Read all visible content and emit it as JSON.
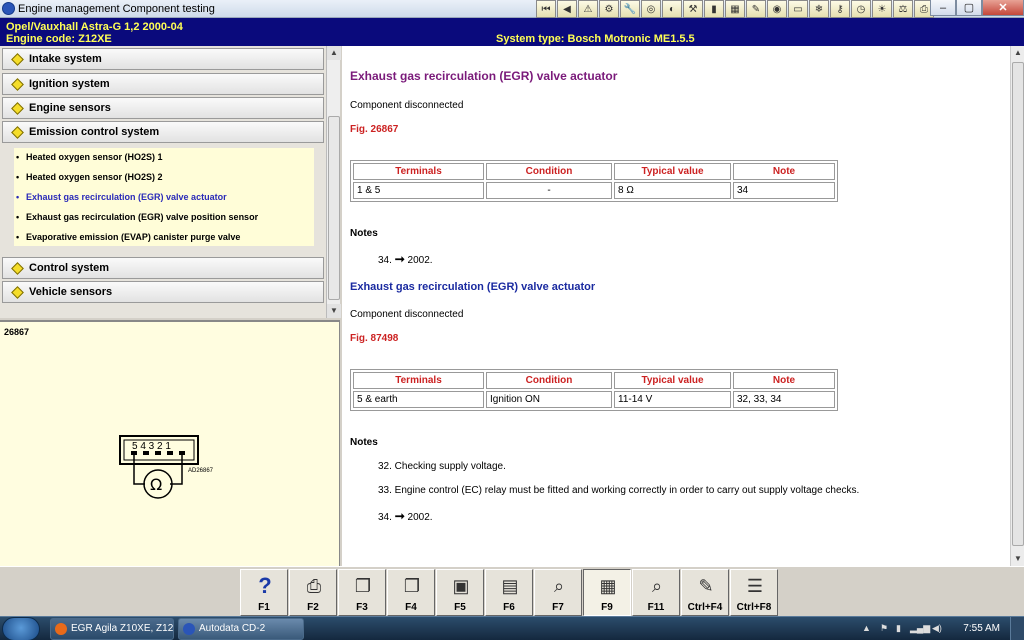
{
  "window": {
    "title": "Engine management Component testing"
  },
  "toolbar_icons": [
    "first-icon",
    "prev-icon",
    "warning-icon",
    "engine-icon",
    "tool-icon",
    "wheel-icon",
    "gauge-icon",
    "jack-icon",
    "battery-icon",
    "calendar-icon",
    "repair-icon",
    "airbag-icon",
    "car-icon",
    "aircon-icon",
    "key-icon",
    "clock-icon",
    "light-icon",
    "weight-icon",
    "print-icon"
  ],
  "header": {
    "vehicle": "Opel/Vauxhall   Astra-G  1,2  2000-04",
    "engine_code": "Engine code: Z12XE",
    "system_type": "System type: Bosch Motronic ME1.5.5"
  },
  "nav": {
    "sections": [
      "Intake system",
      "Ignition system",
      "Engine sensors",
      "Emission control system",
      "Control system",
      "Vehicle sensors"
    ],
    "sub_items": [
      "Heated oxygen sensor (HO2S) 1",
      "Heated oxygen sensor (HO2S) 2",
      "Exhaust gas recirculation (EGR) valve actuator",
      "Exhaust gas recirculation (EGR) valve position sensor",
      "Evaporative emission (EVAP) canister purge valve"
    ]
  },
  "figure": {
    "number": "26867",
    "pins": "5 4 3 2 1",
    "ref": "AD26867",
    "ohm": "Ω"
  },
  "content": {
    "title": "Exhaust gas recirculation (EGR) valve actuator",
    "block1": {
      "status": "Component disconnected",
      "fig": "Fig. 26867",
      "headers": [
        "Terminals",
        "Condition",
        "Typical value",
        "Note"
      ],
      "row": [
        "1 & 5",
        "-",
        "8 Ω",
        "34"
      ]
    },
    "notes_label": "Notes",
    "notes1": [
      {
        "num": "34.",
        "arrow": "➞",
        "text": "2002."
      }
    ],
    "block2": {
      "title": "Exhaust gas recirculation (EGR) valve actuator",
      "status": "Component disconnected",
      "fig": "Fig. 87498",
      "headers": [
        "Terminals",
        "Condition",
        "Typical value",
        "Note"
      ],
      "row": [
        "5 & earth",
        "Ignition ON",
        "11-14 V",
        "32, 33, 34"
      ]
    },
    "notes2": [
      {
        "text": "32. Checking supply voltage."
      },
      {
        "text": "33. Engine control (EC) relay must be fitted and working correctly in order to carry out supply voltage checks."
      },
      {
        "num": "34.",
        "arrow": "➞",
        "text": "2002."
      }
    ]
  },
  "fkeys": [
    {
      "label": "F1",
      "icon": "help-icon",
      "glyph": "?"
    },
    {
      "label": "F2",
      "icon": "print-icon",
      "glyph": "⎙"
    },
    {
      "label": "F3",
      "icon": "copy-icon",
      "glyph": "❐"
    },
    {
      "label": "F4",
      "icon": "copy2-icon",
      "glyph": "❐"
    },
    {
      "label": "F5",
      "icon": "component-icon",
      "glyph": "▣"
    },
    {
      "label": "F6",
      "icon": "connector-icon",
      "glyph": "▤"
    },
    {
      "label": "F7",
      "icon": "magnify-icon",
      "glyph": "⌕"
    },
    {
      "label": "F9",
      "icon": "tech-icon",
      "glyph": "▦"
    },
    {
      "label": "F11",
      "icon": "search-doc-icon",
      "glyph": "⌕"
    },
    {
      "label": "Ctrl+F4",
      "icon": "notes-icon",
      "glyph": "✎"
    },
    {
      "label": "Ctrl+F8",
      "icon": "list-icon",
      "glyph": "☰"
    }
  ],
  "taskbar": {
    "items": [
      "EGR Agila Z10XE, Z12...",
      "Autodata CD-2"
    ],
    "clock": "7:55 AM"
  }
}
